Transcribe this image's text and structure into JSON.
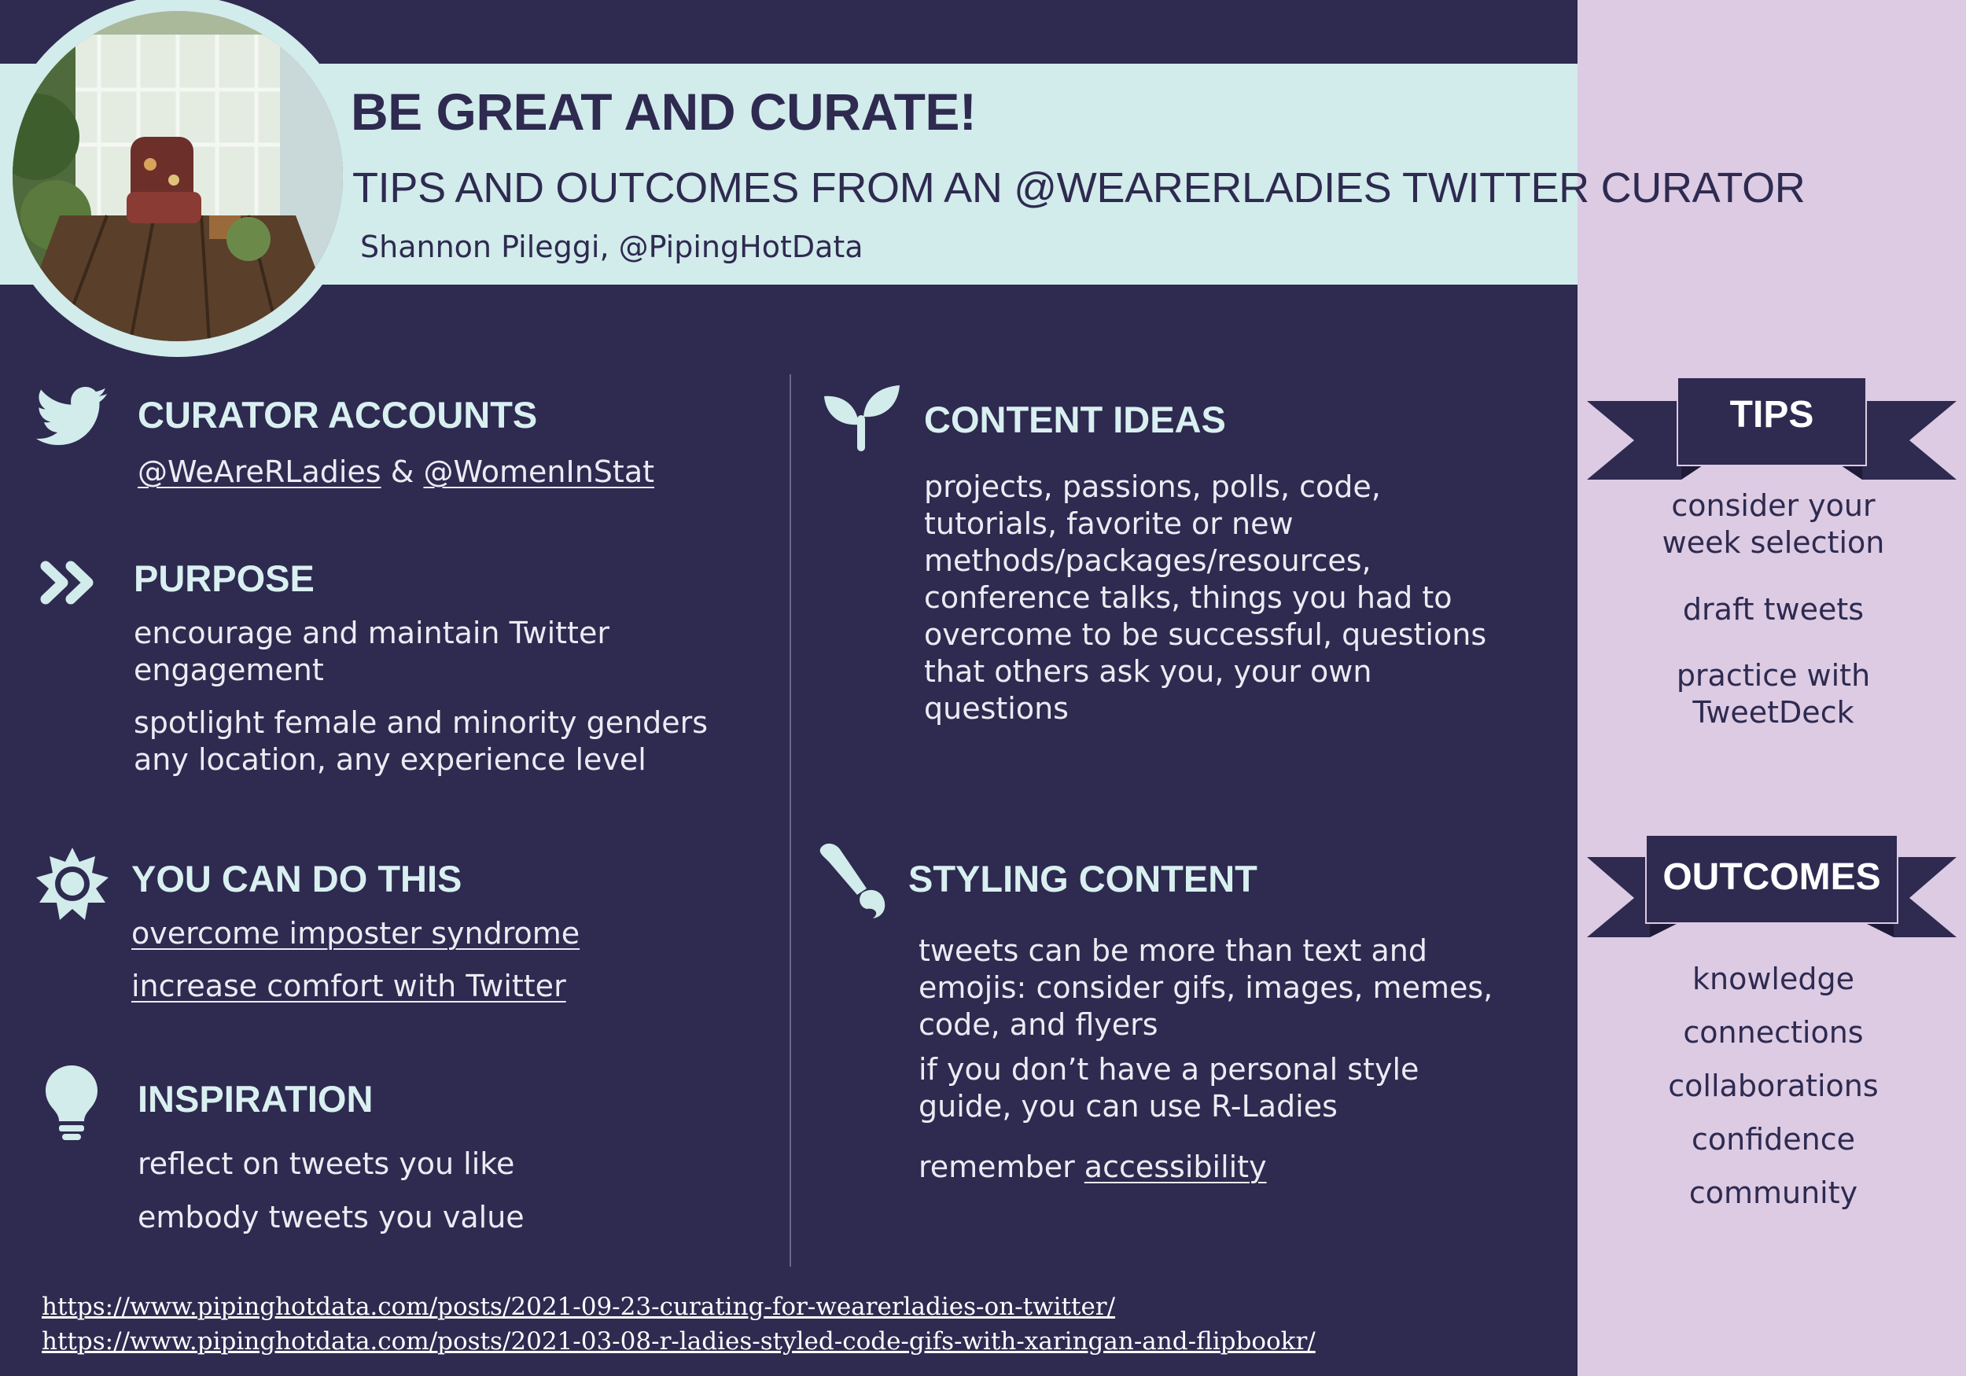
{
  "header": {
    "title": "BE GREAT AND CURATE!",
    "subtitle": "TIPS AND OUTCOMES FROM AN @WEARERLADIES TWITTER CURATOR",
    "author": "Shannon Pileggi, @PipingHotData"
  },
  "curator": {
    "heading": "CURATOR ACCOUNTS",
    "account1": "@WeAreRLadies",
    "amp": "&",
    "account2": "@WomenInStat",
    "icon": "twitter-bird-icon"
  },
  "purpose": {
    "heading": "PURPOSE",
    "line1": "encourage and maintain Twitter",
    "line2": "engagement",
    "line3": "spotlight female and minority genders",
    "line4": "any location, any experience level",
    "icon": "double-chevron-icon"
  },
  "can_do": {
    "heading": "YOU CAN DO THIS",
    "link1": "overcome imposter syndrome",
    "link2": "increase comfort with Twitter",
    "icon": "sun-icon"
  },
  "inspiration": {
    "heading": "INSPIRATION",
    "line1": "reflect on tweets you like",
    "line2": "embody tweets you value",
    "icon": "lightbulb-icon"
  },
  "content_ideas": {
    "heading": "CONTENT IDEAS",
    "lines": [
      "projects, passions, polls, code,",
      "tutorials, favorite or new",
      "methods/packages/resources,",
      "conference talks, things you had to",
      "overcome to be successful, questions",
      "that others ask you, your own",
      "questions"
    ],
    "icon": "sprout-icon"
  },
  "styling": {
    "heading": "STYLING CONTENT",
    "p1": [
      "tweets can be more than text and",
      "emojis: consider gifs, images, memes,",
      "code, and flyers"
    ],
    "p2": [
      "if you don’t have a personal style",
      "guide, you can use R-Ladies"
    ],
    "p3_prefix": "remember ",
    "p3_link": "accessibility",
    "icon": "paintbrush-icon"
  },
  "tips": {
    "label": "TIPS",
    "items": [
      [
        "consider your",
        "week selection"
      ],
      [
        "draft tweets"
      ],
      [
        "practice with",
        "TweetDeck"
      ]
    ]
  },
  "outcomes": {
    "label": "OUTCOMES",
    "items": [
      "knowledge",
      "connections",
      "collaborations",
      "confidence",
      "community"
    ]
  },
  "footer": {
    "url1": "https://www.pipinghotdata.com/posts/2021-09-23-curating-for-wearerladies-on-twitter/",
    "url2": "https://www.pipinghotdata.com/posts/2021-03-08-r-ladies-styled-code-gifs-with-xaringan-and-flipbookr/"
  },
  "colors": {
    "background": "#2e2a50",
    "header_band": "#d2ebeb",
    "side_bar": "#dccbe3",
    "ribbon": "#2e2a50"
  }
}
